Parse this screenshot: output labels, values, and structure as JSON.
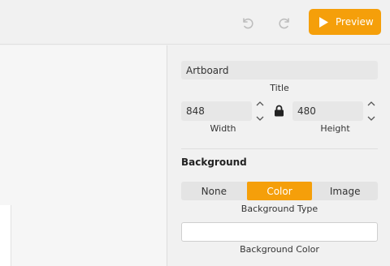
{
  "toolbar": {
    "undo_icon": "undo-icon",
    "redo_icon": "redo-icon",
    "preview_label": "Preview",
    "preview_color": "#f59f0a"
  },
  "panel": {
    "title_value": "Artboard",
    "title_label": "Title",
    "width_value": "848",
    "width_label": "Width",
    "height_value": "480",
    "height_label": "Height",
    "lock_icon": "lock-icon",
    "background_heading": "Background",
    "background_type": {
      "options": [
        "None",
        "Color",
        "Image"
      ],
      "selected": "Color",
      "label": "Background Type"
    },
    "background_color_value": "",
    "background_color_label": "Background Color"
  }
}
